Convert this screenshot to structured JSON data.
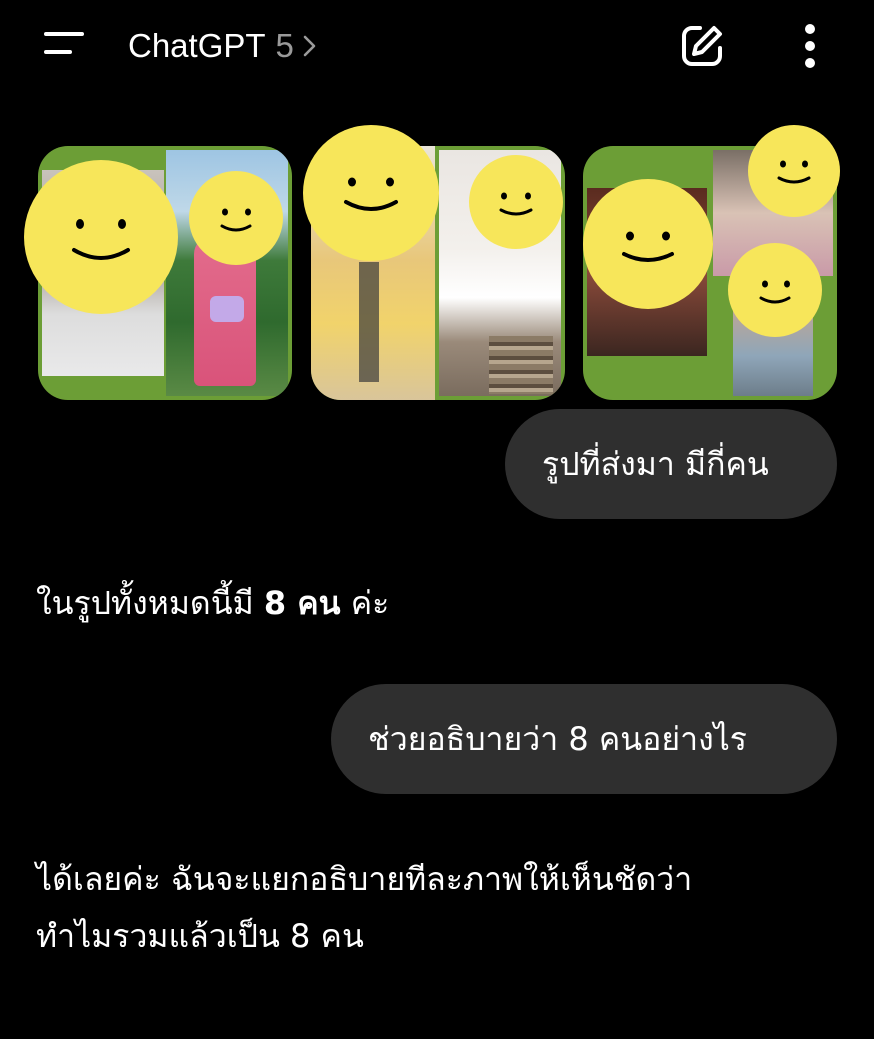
{
  "header": {
    "title": "ChatGPT",
    "version": "5",
    "menu_icon": "menu-icon",
    "chevron_icon": "chevron-right-icon",
    "new_chat_icon": "edit-icon",
    "more_icon": "more-vertical-icon"
  },
  "attachments": [
    {
      "type": "image",
      "description_icon": "photo-thumbnail"
    },
    {
      "type": "image",
      "description_icon": "photo-thumbnail"
    },
    {
      "type": "image",
      "description_icon": "photo-thumbnail"
    }
  ],
  "messages": [
    {
      "role": "user",
      "text": "รูปที่ส่งมา มีกี่คน"
    },
    {
      "role": "assistant",
      "text_before": "ในรูปทั้งหมดนี้มี ",
      "text_bold": "8 คน",
      "text_after": " ค่ะ"
    },
    {
      "role": "user",
      "text": "ช่วยอธิบายว่า 8 คนอย่างไร"
    },
    {
      "role": "assistant",
      "text": "ได้เลยค่ะ ฉันจะแยกอธิบายทีละภาพให้เห็นชัดว่า\nทำไมรวมแล้วเป็น 8 คน"
    }
  ],
  "colors": {
    "background": "#000000",
    "user_bubble": "#2f2f2f",
    "collage_frame": "#6c9e36",
    "smiley": "#f7e65a"
  }
}
